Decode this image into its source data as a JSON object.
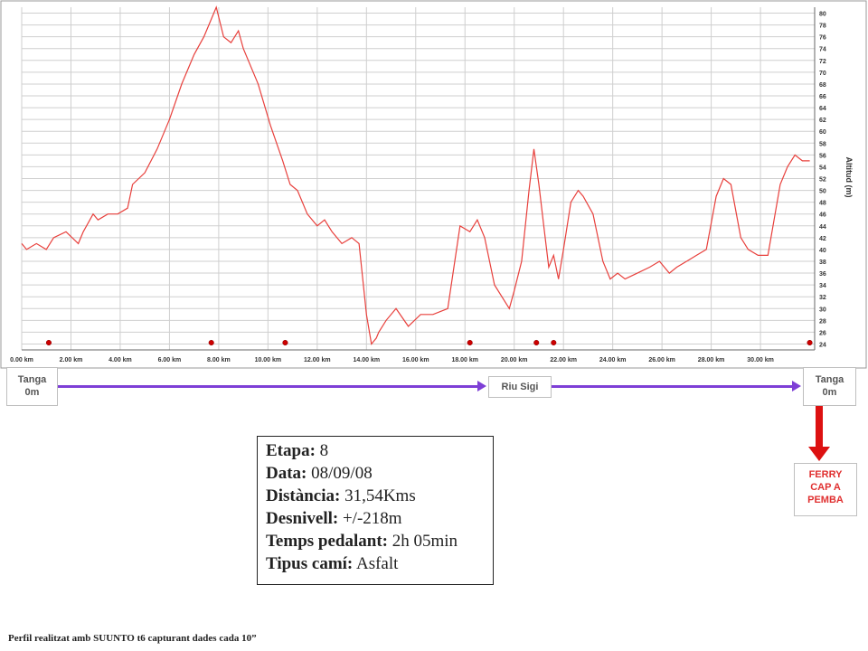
{
  "chart_data": {
    "type": "line",
    "title": "",
    "xlabel": "",
    "ylabel": "Altitud (m)",
    "xlim": [
      0,
      32.2
    ],
    "ylim": [
      23,
      81
    ],
    "x_ticks": [
      0,
      2,
      4,
      6,
      8,
      10,
      12,
      14,
      16,
      18,
      20,
      22,
      24,
      26,
      28,
      30
    ],
    "x_tick_labels": [
      "0.00 km",
      "2.00 km",
      "4.00 km",
      "6.00 km",
      "8.00 km",
      "10.00 km",
      "12.00 km",
      "14.00 km",
      "16.00 km",
      "18.00 km",
      "20.00 km",
      "22.00 km",
      "24.00 km",
      "26.00 km",
      "28.00 km",
      "30.00 km"
    ],
    "y_ticks": [
      24,
      26,
      28,
      30,
      32,
      34,
      36,
      38,
      40,
      42,
      44,
      46,
      48,
      50,
      52,
      54,
      56,
      58,
      60,
      62,
      64,
      66,
      68,
      70,
      72,
      74,
      76,
      78,
      80
    ],
    "grid": true,
    "line_color": "#e8403c",
    "series": [
      {
        "x": [
          0.0,
          0.2,
          0.6,
          1.0,
          1.3,
          1.8,
          2.3,
          2.5,
          2.9,
          3.1,
          3.5,
          3.9,
          4.3,
          4.5,
          5.0,
          5.5,
          6.0,
          6.5,
          7.0,
          7.4,
          7.6,
          7.9,
          8.2,
          8.5,
          8.8,
          9.0,
          9.6,
          10.1,
          10.6,
          10.9,
          11.2,
          11.6,
          12.0,
          12.3,
          12.6,
          13.0,
          13.4,
          13.7,
          14.0,
          14.2,
          14.4,
          14.5,
          14.8,
          15.2,
          15.7,
          16.2,
          16.7,
          17.3,
          17.8,
          18.2,
          18.5,
          18.8,
          19.2,
          19.8,
          20.0,
          20.3,
          20.6,
          20.8,
          21.0,
          21.2,
          21.4,
          21.6,
          21.8,
          22.0,
          22.3,
          22.6,
          22.8,
          23.2,
          23.6,
          23.9,
          24.2,
          24.5,
          25.0,
          25.5,
          25.9,
          26.3,
          26.6,
          27.0,
          27.4,
          27.8,
          28.2,
          28.5,
          28.8,
          29.2,
          29.5,
          29.9,
          30.3,
          30.8,
          31.1,
          31.4,
          31.7,
          32.0
        ],
        "y": [
          41,
          40,
          41,
          40,
          42,
          43,
          41,
          43,
          46,
          45,
          46,
          46,
          47,
          51,
          53,
          57,
          62,
          68,
          73,
          76,
          78,
          81,
          76,
          75,
          77,
          74,
          68,
          61,
          55,
          51,
          50,
          46,
          44,
          45,
          43,
          41,
          42,
          41,
          29,
          24,
          25,
          26,
          28,
          30,
          27,
          29,
          29,
          30,
          44,
          43,
          45,
          42,
          34,
          30,
          33,
          38,
          50,
          57,
          51,
          44,
          37,
          39,
          35,
          40,
          48,
          50,
          49,
          46,
          38,
          35,
          36,
          35,
          36,
          37,
          38,
          36,
          37,
          38,
          39,
          40,
          49,
          52,
          51,
          42,
          40,
          39,
          39,
          51,
          54,
          56,
          55,
          55
        ]
      }
    ],
    "markers_x": [
      1.1,
      7.7,
      10.7,
      18.2,
      20.9,
      21.6,
      32.0
    ]
  },
  "route": {
    "start": {
      "name": "Tanga",
      "alt": "0m"
    },
    "mid": {
      "name": "Riu Sigi"
    },
    "end": {
      "name": "Tanga",
      "alt": "0m"
    },
    "ferry": {
      "line1": "FERRY",
      "line2": "CAP A",
      "line3": "PEMBA"
    }
  },
  "stage_info": {
    "etapa_label": "Etapa:",
    "etapa_value": "8",
    "data_label": "Data:",
    "data_value": "08/09/08",
    "distancia_label": "Distància:",
    "distancia_value": "31,54Kms",
    "desnivell_label": "Desnivell:",
    "desnivell_value": "+/-218m",
    "temps_label": "Temps pedalant:",
    "temps_value": "2h 05min",
    "cami_label": "Tipus camí:",
    "cami_value": "Asfalt"
  },
  "footer": "Perfil realitzat amb SUUNTO t6 capturant dades cada 10”"
}
